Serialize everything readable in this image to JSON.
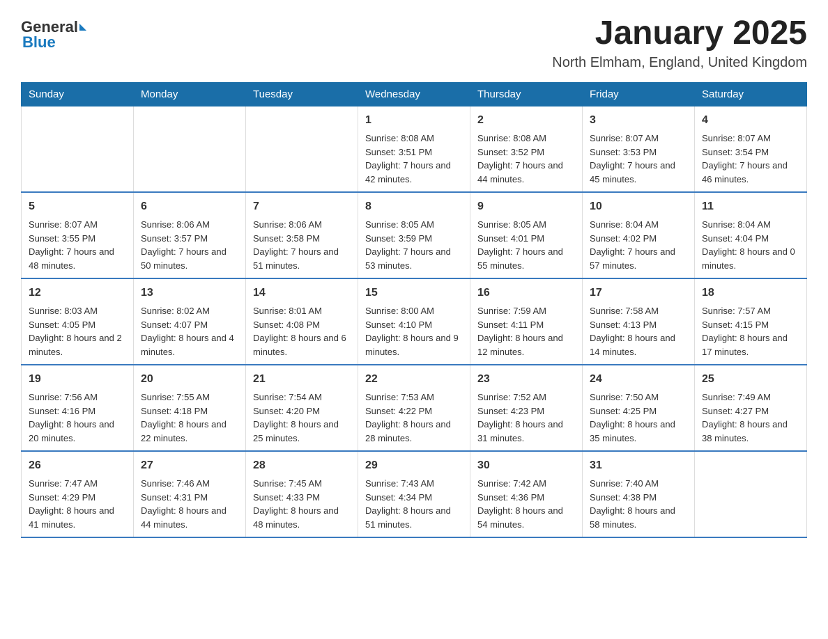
{
  "header": {
    "logo_general": "General",
    "logo_blue": "Blue",
    "month_title": "January 2025",
    "location": "North Elmham, England, United Kingdom"
  },
  "days_of_week": [
    "Sunday",
    "Monday",
    "Tuesday",
    "Wednesday",
    "Thursday",
    "Friday",
    "Saturday"
  ],
  "weeks": [
    [
      {
        "day": "",
        "sunrise": "",
        "sunset": "",
        "daylight": ""
      },
      {
        "day": "",
        "sunrise": "",
        "sunset": "",
        "daylight": ""
      },
      {
        "day": "",
        "sunrise": "",
        "sunset": "",
        "daylight": ""
      },
      {
        "day": "1",
        "sunrise": "Sunrise: 8:08 AM",
        "sunset": "Sunset: 3:51 PM",
        "daylight": "Daylight: 7 hours and 42 minutes."
      },
      {
        "day": "2",
        "sunrise": "Sunrise: 8:08 AM",
        "sunset": "Sunset: 3:52 PM",
        "daylight": "Daylight: 7 hours and 44 minutes."
      },
      {
        "day": "3",
        "sunrise": "Sunrise: 8:07 AM",
        "sunset": "Sunset: 3:53 PM",
        "daylight": "Daylight: 7 hours and 45 minutes."
      },
      {
        "day": "4",
        "sunrise": "Sunrise: 8:07 AM",
        "sunset": "Sunset: 3:54 PM",
        "daylight": "Daylight: 7 hours and 46 minutes."
      }
    ],
    [
      {
        "day": "5",
        "sunrise": "Sunrise: 8:07 AM",
        "sunset": "Sunset: 3:55 PM",
        "daylight": "Daylight: 7 hours and 48 minutes."
      },
      {
        "day": "6",
        "sunrise": "Sunrise: 8:06 AM",
        "sunset": "Sunset: 3:57 PM",
        "daylight": "Daylight: 7 hours and 50 minutes."
      },
      {
        "day": "7",
        "sunrise": "Sunrise: 8:06 AM",
        "sunset": "Sunset: 3:58 PM",
        "daylight": "Daylight: 7 hours and 51 minutes."
      },
      {
        "day": "8",
        "sunrise": "Sunrise: 8:05 AM",
        "sunset": "Sunset: 3:59 PM",
        "daylight": "Daylight: 7 hours and 53 minutes."
      },
      {
        "day": "9",
        "sunrise": "Sunrise: 8:05 AM",
        "sunset": "Sunset: 4:01 PM",
        "daylight": "Daylight: 7 hours and 55 minutes."
      },
      {
        "day": "10",
        "sunrise": "Sunrise: 8:04 AM",
        "sunset": "Sunset: 4:02 PM",
        "daylight": "Daylight: 7 hours and 57 minutes."
      },
      {
        "day": "11",
        "sunrise": "Sunrise: 8:04 AM",
        "sunset": "Sunset: 4:04 PM",
        "daylight": "Daylight: 8 hours and 0 minutes."
      }
    ],
    [
      {
        "day": "12",
        "sunrise": "Sunrise: 8:03 AM",
        "sunset": "Sunset: 4:05 PM",
        "daylight": "Daylight: 8 hours and 2 minutes."
      },
      {
        "day": "13",
        "sunrise": "Sunrise: 8:02 AM",
        "sunset": "Sunset: 4:07 PM",
        "daylight": "Daylight: 8 hours and 4 minutes."
      },
      {
        "day": "14",
        "sunrise": "Sunrise: 8:01 AM",
        "sunset": "Sunset: 4:08 PM",
        "daylight": "Daylight: 8 hours and 6 minutes."
      },
      {
        "day": "15",
        "sunrise": "Sunrise: 8:00 AM",
        "sunset": "Sunset: 4:10 PM",
        "daylight": "Daylight: 8 hours and 9 minutes."
      },
      {
        "day": "16",
        "sunrise": "Sunrise: 7:59 AM",
        "sunset": "Sunset: 4:11 PM",
        "daylight": "Daylight: 8 hours and 12 minutes."
      },
      {
        "day": "17",
        "sunrise": "Sunrise: 7:58 AM",
        "sunset": "Sunset: 4:13 PM",
        "daylight": "Daylight: 8 hours and 14 minutes."
      },
      {
        "day": "18",
        "sunrise": "Sunrise: 7:57 AM",
        "sunset": "Sunset: 4:15 PM",
        "daylight": "Daylight: 8 hours and 17 minutes."
      }
    ],
    [
      {
        "day": "19",
        "sunrise": "Sunrise: 7:56 AM",
        "sunset": "Sunset: 4:16 PM",
        "daylight": "Daylight: 8 hours and 20 minutes."
      },
      {
        "day": "20",
        "sunrise": "Sunrise: 7:55 AM",
        "sunset": "Sunset: 4:18 PM",
        "daylight": "Daylight: 8 hours and 22 minutes."
      },
      {
        "day": "21",
        "sunrise": "Sunrise: 7:54 AM",
        "sunset": "Sunset: 4:20 PM",
        "daylight": "Daylight: 8 hours and 25 minutes."
      },
      {
        "day": "22",
        "sunrise": "Sunrise: 7:53 AM",
        "sunset": "Sunset: 4:22 PM",
        "daylight": "Daylight: 8 hours and 28 minutes."
      },
      {
        "day": "23",
        "sunrise": "Sunrise: 7:52 AM",
        "sunset": "Sunset: 4:23 PM",
        "daylight": "Daylight: 8 hours and 31 minutes."
      },
      {
        "day": "24",
        "sunrise": "Sunrise: 7:50 AM",
        "sunset": "Sunset: 4:25 PM",
        "daylight": "Daylight: 8 hours and 35 minutes."
      },
      {
        "day": "25",
        "sunrise": "Sunrise: 7:49 AM",
        "sunset": "Sunset: 4:27 PM",
        "daylight": "Daylight: 8 hours and 38 minutes."
      }
    ],
    [
      {
        "day": "26",
        "sunrise": "Sunrise: 7:47 AM",
        "sunset": "Sunset: 4:29 PM",
        "daylight": "Daylight: 8 hours and 41 minutes."
      },
      {
        "day": "27",
        "sunrise": "Sunrise: 7:46 AM",
        "sunset": "Sunset: 4:31 PM",
        "daylight": "Daylight: 8 hours and 44 minutes."
      },
      {
        "day": "28",
        "sunrise": "Sunrise: 7:45 AM",
        "sunset": "Sunset: 4:33 PM",
        "daylight": "Daylight: 8 hours and 48 minutes."
      },
      {
        "day": "29",
        "sunrise": "Sunrise: 7:43 AM",
        "sunset": "Sunset: 4:34 PM",
        "daylight": "Daylight: 8 hours and 51 minutes."
      },
      {
        "day": "30",
        "sunrise": "Sunrise: 7:42 AM",
        "sunset": "Sunset: 4:36 PM",
        "daylight": "Daylight: 8 hours and 54 minutes."
      },
      {
        "day": "31",
        "sunrise": "Sunrise: 7:40 AM",
        "sunset": "Sunset: 4:38 PM",
        "daylight": "Daylight: 8 hours and 58 minutes."
      },
      {
        "day": "",
        "sunrise": "",
        "sunset": "",
        "daylight": ""
      }
    ]
  ]
}
